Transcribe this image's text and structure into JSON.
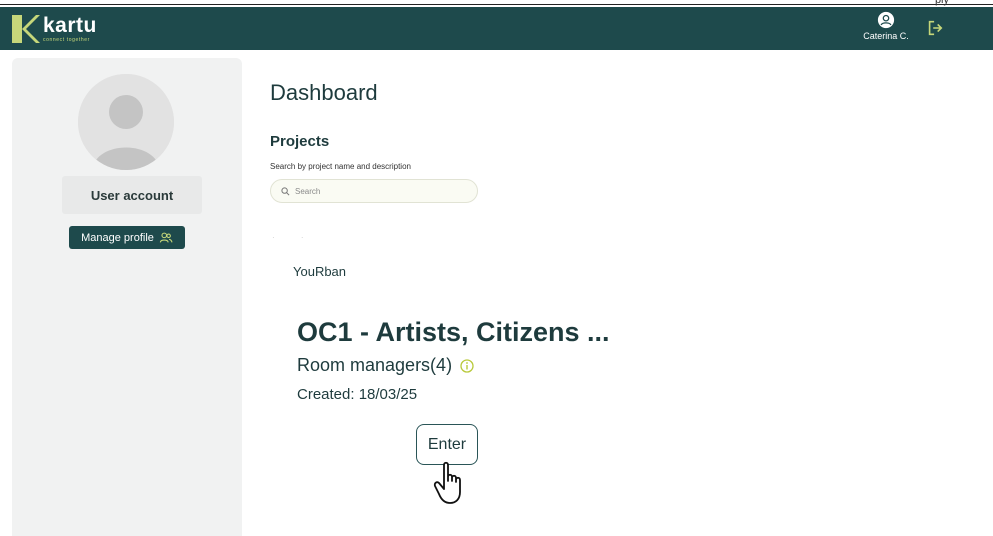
{
  "top_corner_text": "ply",
  "header": {
    "logo_name": "kartu",
    "logo_tagline": "connect together",
    "user_name": "Caterina C.",
    "icons": {
      "user": "user-circle-icon",
      "logout": "logout-icon"
    }
  },
  "sidebar": {
    "user_account_label": "User account",
    "manage_profile_label": "Manage profile"
  },
  "main": {
    "title": "Dashboard",
    "projects_heading": "Projects",
    "search_label": "Search by project name and description",
    "search_placeholder": "Search",
    "faint_dots": "· ·",
    "project": {
      "organization": "YouRban",
      "title": "OC1 - Artists, Citizens ...",
      "room_managers": "Room managers(4)",
      "created": "Created: 18/03/25",
      "enter_label": "Enter"
    }
  },
  "colors": {
    "header_bg": "#1e4a4c",
    "accent_green": "#c6d77a",
    "text_dark": "#1e3b3d",
    "sidebar_bg": "#f1f2f2"
  }
}
